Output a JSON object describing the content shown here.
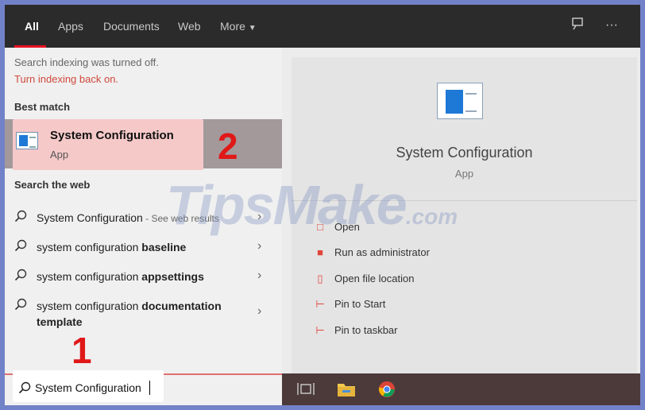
{
  "tabs": [
    {
      "label": "All",
      "active": true
    },
    {
      "label": "Apps"
    },
    {
      "label": "Documents"
    },
    {
      "label": "Web"
    },
    {
      "label": "More"
    }
  ],
  "notice": {
    "text": "Search indexing was turned off.",
    "link": "Turn indexing back on."
  },
  "best_match": {
    "header": "Best match",
    "title": "System Configuration",
    "subtitle": "App",
    "icon": "system-configuration-icon"
  },
  "search_web": {
    "header": "Search the web",
    "results": [
      {
        "prefix": "System Configuration",
        "bold": "",
        "hint": " - See web results"
      },
      {
        "prefix": "system configuration ",
        "bold": "baseline",
        "hint": ""
      },
      {
        "prefix": "system configuration ",
        "bold": "appsettings",
        "hint": ""
      },
      {
        "prefix": "system configuration ",
        "bold": "documentation",
        "line2": "template",
        "hint": ""
      }
    ]
  },
  "preview": {
    "title": "System Configuration",
    "subtitle": "App",
    "actions": [
      {
        "label": "Open",
        "icon": "open-icon"
      },
      {
        "label": "Run as administrator",
        "icon": "shield-icon"
      },
      {
        "label": "Open file location",
        "icon": "file-icon"
      },
      {
        "label": "Pin to Start",
        "icon": "pin-icon"
      },
      {
        "label": "Pin to taskbar",
        "icon": "pin-icon"
      }
    ]
  },
  "search": {
    "value": "System Configuration"
  },
  "annotations": {
    "step1": "1",
    "step2": "2"
  },
  "watermark": {
    "main": "TipsMake",
    "suffix": ".com"
  },
  "colors": {
    "accent": "#e81123",
    "annotation": "#e01818",
    "highlight": "#f6c9c9"
  }
}
